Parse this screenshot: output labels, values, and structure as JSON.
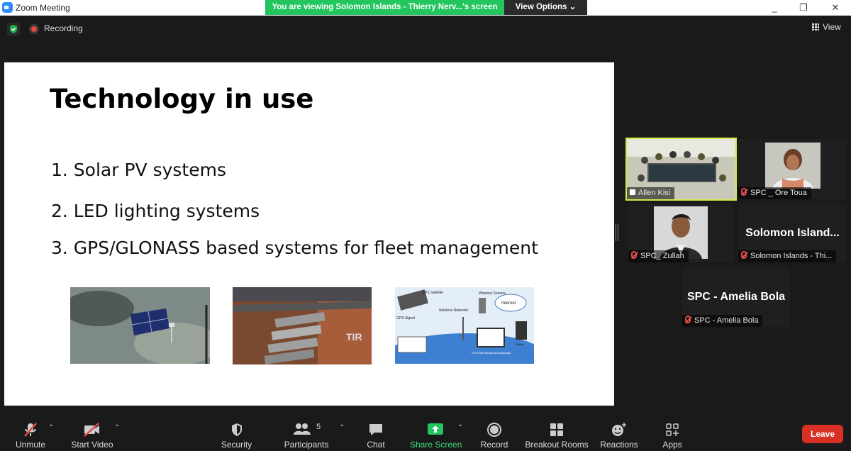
{
  "window": {
    "title": "Zoom Meeting",
    "controls": [
      "_",
      "❐",
      "✕"
    ]
  },
  "share_banner": {
    "text": "You are viewing Solomon Islands - Thierry Nerv...'s screen",
    "view_options": "View Options ⌄"
  },
  "topbar": {
    "recording_label": "Recording",
    "view_label": "View"
  },
  "slide": {
    "title": "Technology in use",
    "bullets": [
      "1.  Solar PV systems",
      "2.  LED lighting systems",
      "3.  GPS/GLONASS based systems for fleet management"
    ],
    "diagram_labels": {
      "satellite": "GPS Satellite",
      "servers": "Wireless Servers",
      "internet": "Internet",
      "signal": "GPS Signal",
      "networks": "Wireless Networks",
      "mobile": "Mobile",
      "app": "GPS Fleet Management Application"
    }
  },
  "participants": [
    {
      "name": "Allen Kisi",
      "muted": false,
      "active_speaker": true
    },
    {
      "name": "SPC _ Ore Toua",
      "muted": true
    },
    {
      "name": "SPC_ Zullah",
      "muted": true
    },
    {
      "name": "Solomon Islands - Thi...",
      "big_name": "Solomon  Island...",
      "muted": true
    },
    {
      "name": "SPC - Amelia Bola",
      "big_name": "SPC - Amelia Bola",
      "muted": true
    }
  ],
  "toolbar": {
    "unmute": "Unmute",
    "start_video": "Start Video",
    "security": "Security",
    "participants": "Participants",
    "participants_count": "5",
    "chat": "Chat",
    "share_screen": "Share Screen",
    "record": "Record",
    "breakout_rooms": "Breakout Rooms",
    "reactions": "Reactions",
    "apps": "Apps",
    "leave": "Leave"
  },
  "colors": {
    "share_green": "#22c55e",
    "leave_red": "#d93025",
    "speaker_border": "#d5e84a",
    "muted_red": "#e24b4b"
  }
}
